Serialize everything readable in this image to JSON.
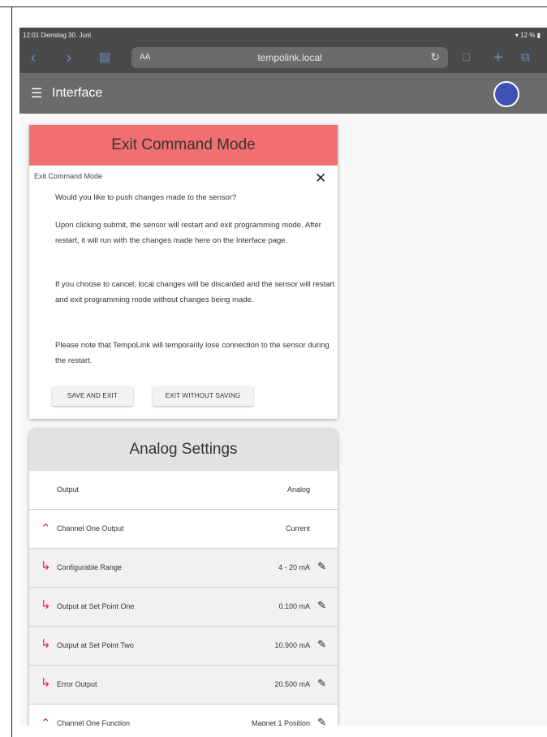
{
  "status": {
    "time_date": "12:01  Dienstag 30. Juni",
    "battery": "12 %"
  },
  "browser": {
    "aa": "AA",
    "url": "tempolink.local"
  },
  "appbar": {
    "title": "Interface"
  },
  "dialog": {
    "header": "Exit Command Mode",
    "subtitle": "Exit Command Mode",
    "paragraphs": [
      "Would you like to push changes made to the sensor?",
      "Upon clicking submit, the sensor will restart and exit programming mode. After restart, it will run with the changes made here on the Interface page.",
      "If you choose to cancel, local changes will be discarded and the sensor will restart and exit programming mode without changes being made.",
      "Please note that TempoLink will temporarily lose connection to the sensor during the restart."
    ],
    "save_label": "SAVE AND EXIT",
    "exit_label": "EXIT WITHOUT SAVING"
  },
  "analog": {
    "title": "Analog Settings",
    "rows": [
      {
        "label": "Output",
        "value": "Analog"
      },
      {
        "label": "Channel One Output",
        "value": "Current"
      },
      {
        "label": "Configurable Range",
        "value": "4 - 20 mA"
      },
      {
        "label": "Output at Set Point One",
        "value": "0.100 mA"
      },
      {
        "label": "Output at Set Point Two",
        "value": "10.900 mA"
      },
      {
        "label": "Error Output",
        "value": "20.500 mA"
      },
      {
        "label": "Channel One Function",
        "value": "Magnet 1 Position"
      }
    ]
  }
}
